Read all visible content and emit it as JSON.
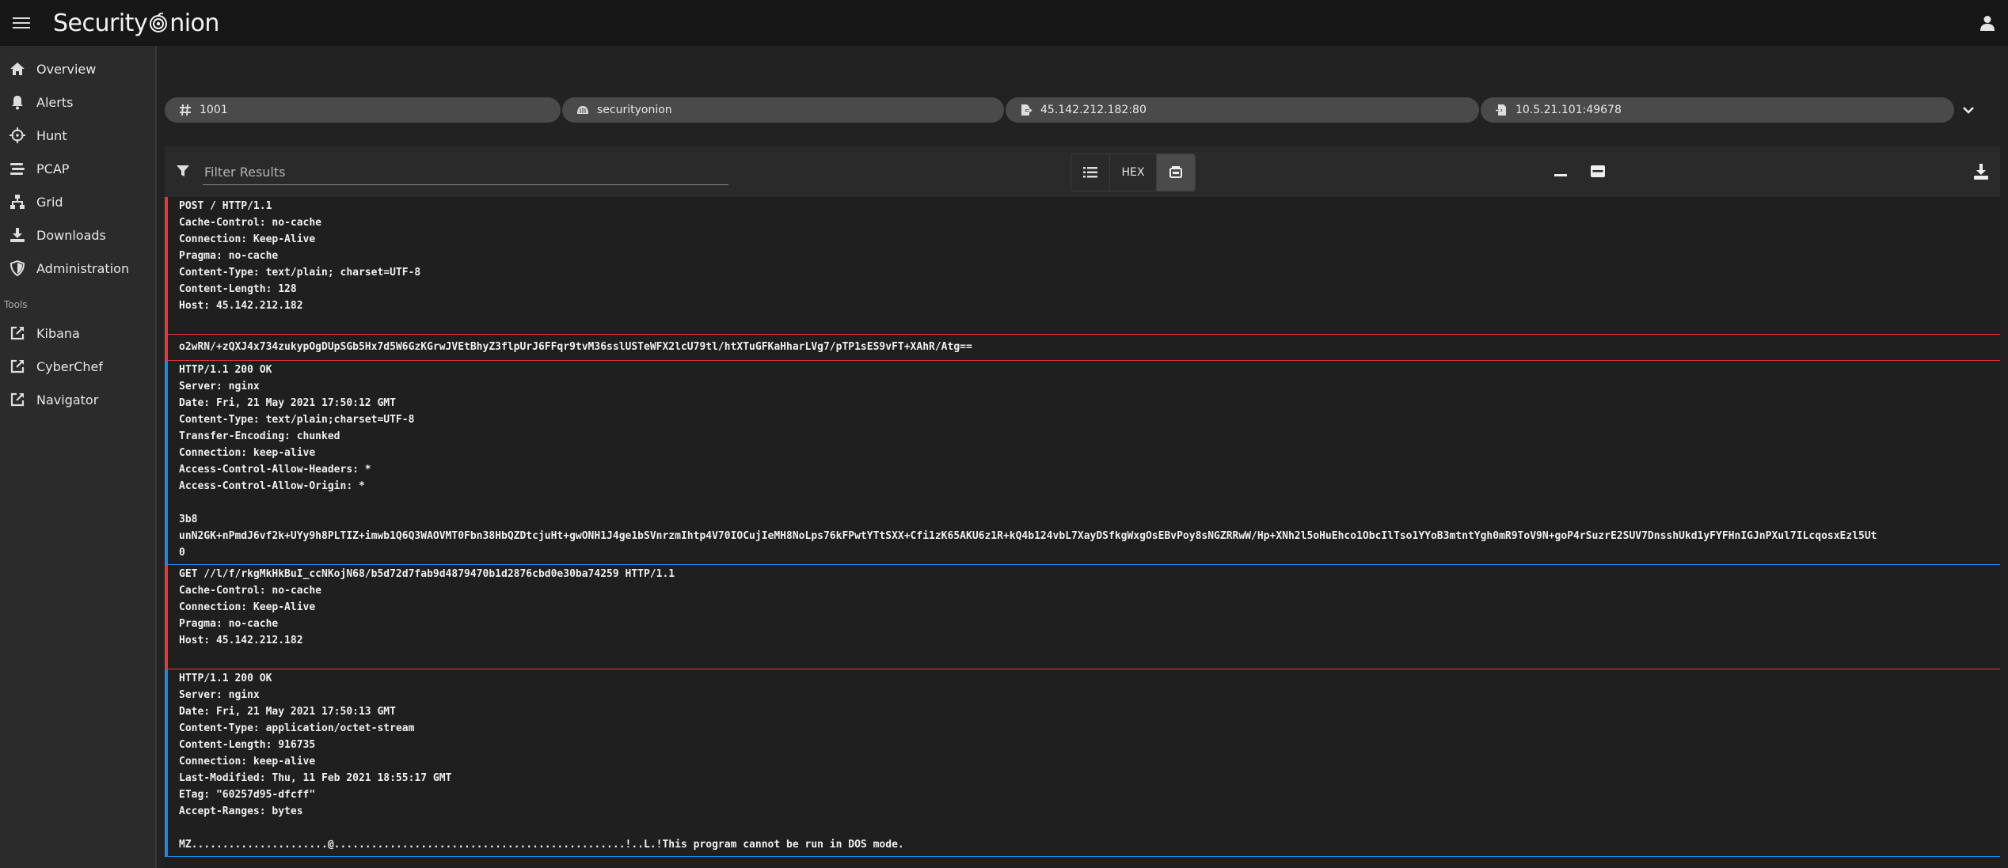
{
  "app": {
    "brand_pre": "Security",
    "brand_post": "nion"
  },
  "sidebar": {
    "items": [
      {
        "label": "Overview",
        "icon": "home-icon"
      },
      {
        "label": "Alerts",
        "icon": "bell-icon"
      },
      {
        "label": "Hunt",
        "icon": "crosshairs-icon"
      },
      {
        "label": "PCAP",
        "icon": "stream-icon"
      },
      {
        "label": "Grid",
        "icon": "network-icon"
      },
      {
        "label": "Downloads",
        "icon": "download-icon"
      },
      {
        "label": "Administration",
        "icon": "shield-icon"
      }
    ],
    "tools_label": "Tools",
    "tools": [
      {
        "label": "Kibana",
        "icon": "external-link-icon"
      },
      {
        "label": "CyberChef",
        "icon": "external-link-icon"
      },
      {
        "label": "Navigator",
        "icon": "external-link-icon"
      }
    ]
  },
  "chips": {
    "job": "1001",
    "sensor": "securityonion",
    "source": "45.142.212.182:80",
    "destination": "10.5.21.101:49678"
  },
  "toolbar": {
    "filter_placeholder": "Filter Results",
    "hex_label": "HEX"
  },
  "transcript": [
    {
      "dir": "client",
      "text": "POST / HTTP/1.1\nCache-Control: no-cache\nConnection: Keep-Alive\nPragma: no-cache\nContent-Type: text/plain; charset=UTF-8\nContent-Length: 128\nHost: 45.142.212.182\n "
    },
    {
      "dir": "client",
      "text": "o2wRN/+zQXJ4x734zukypOgDUpSGb5Hx7d5W6GzKGrwJVEtBhyZ3flpUrJ6FFqr9tvM36sslUSTeWFX2lcU79tl/htXTuGFKaHharLVg7/pTP1sES9vFT+XAhR/Atg=="
    },
    {
      "dir": "server",
      "text": "HTTP/1.1 200 OK\nServer: nginx\nDate: Fri, 21 May 2021 17:50:12 GMT\nContent-Type: text/plain;charset=UTF-8\nTransfer-Encoding: chunked\nConnection: keep-alive\nAccess-Control-Allow-Headers: *\nAccess-Control-Allow-Origin: *\n\n3b8\nunN2GK+nPmdJ6vf2k+UYy9h8PLTIZ+imwb1Q6Q3WAOVMT0Fbn38HbQZDtcjuHt+gwONH1J4ge1bSVnrzmIhtp4V70IOCujIeMH8NoLps76kFPwtYTtSXX+Cfi1zK65AKU6z1R+kQ4b124vbL7XayDSfkgWxgOsEBvPoy8sNGZRRwW/Hp+XNh2l5oHuEhco1ObcIlTso1YYoB3mtntYgh0mR9ToV9N+goP4rSuzrE2SUV7DnsshUkd1yFYFHnIGJnPXul7ILcqosxEzl5Ut\n0"
    },
    {
      "dir": "client",
      "text": "GET //l/f/rkgMkHkBuI_ccNKojN68/b5d72d7fab9d4879470b1d2876cbd0e30ba74259 HTTP/1.1\nCache-Control: no-cache\nConnection: Keep-Alive\nPragma: no-cache\nHost: 45.142.212.182\n "
    },
    {
      "dir": "server",
      "text": "HTTP/1.1 200 OK\nServer: nginx\nDate: Fri, 21 May 2021 17:50:13 GMT\nContent-Type: application/octet-stream\nContent-Length: 916735\nConnection: keep-alive\nLast-Modified: Thu, 11 Feb 2021 18:55:17 GMT\nETag: \"60257d95-dfcff\"\nAccept-Ranges: bytes\n\nMZ......................@...............................................!..L.!This program cannot be run in DOS mode."
    }
  ],
  "colors": {
    "client": "#e53935",
    "server": "#1e88e5"
  }
}
